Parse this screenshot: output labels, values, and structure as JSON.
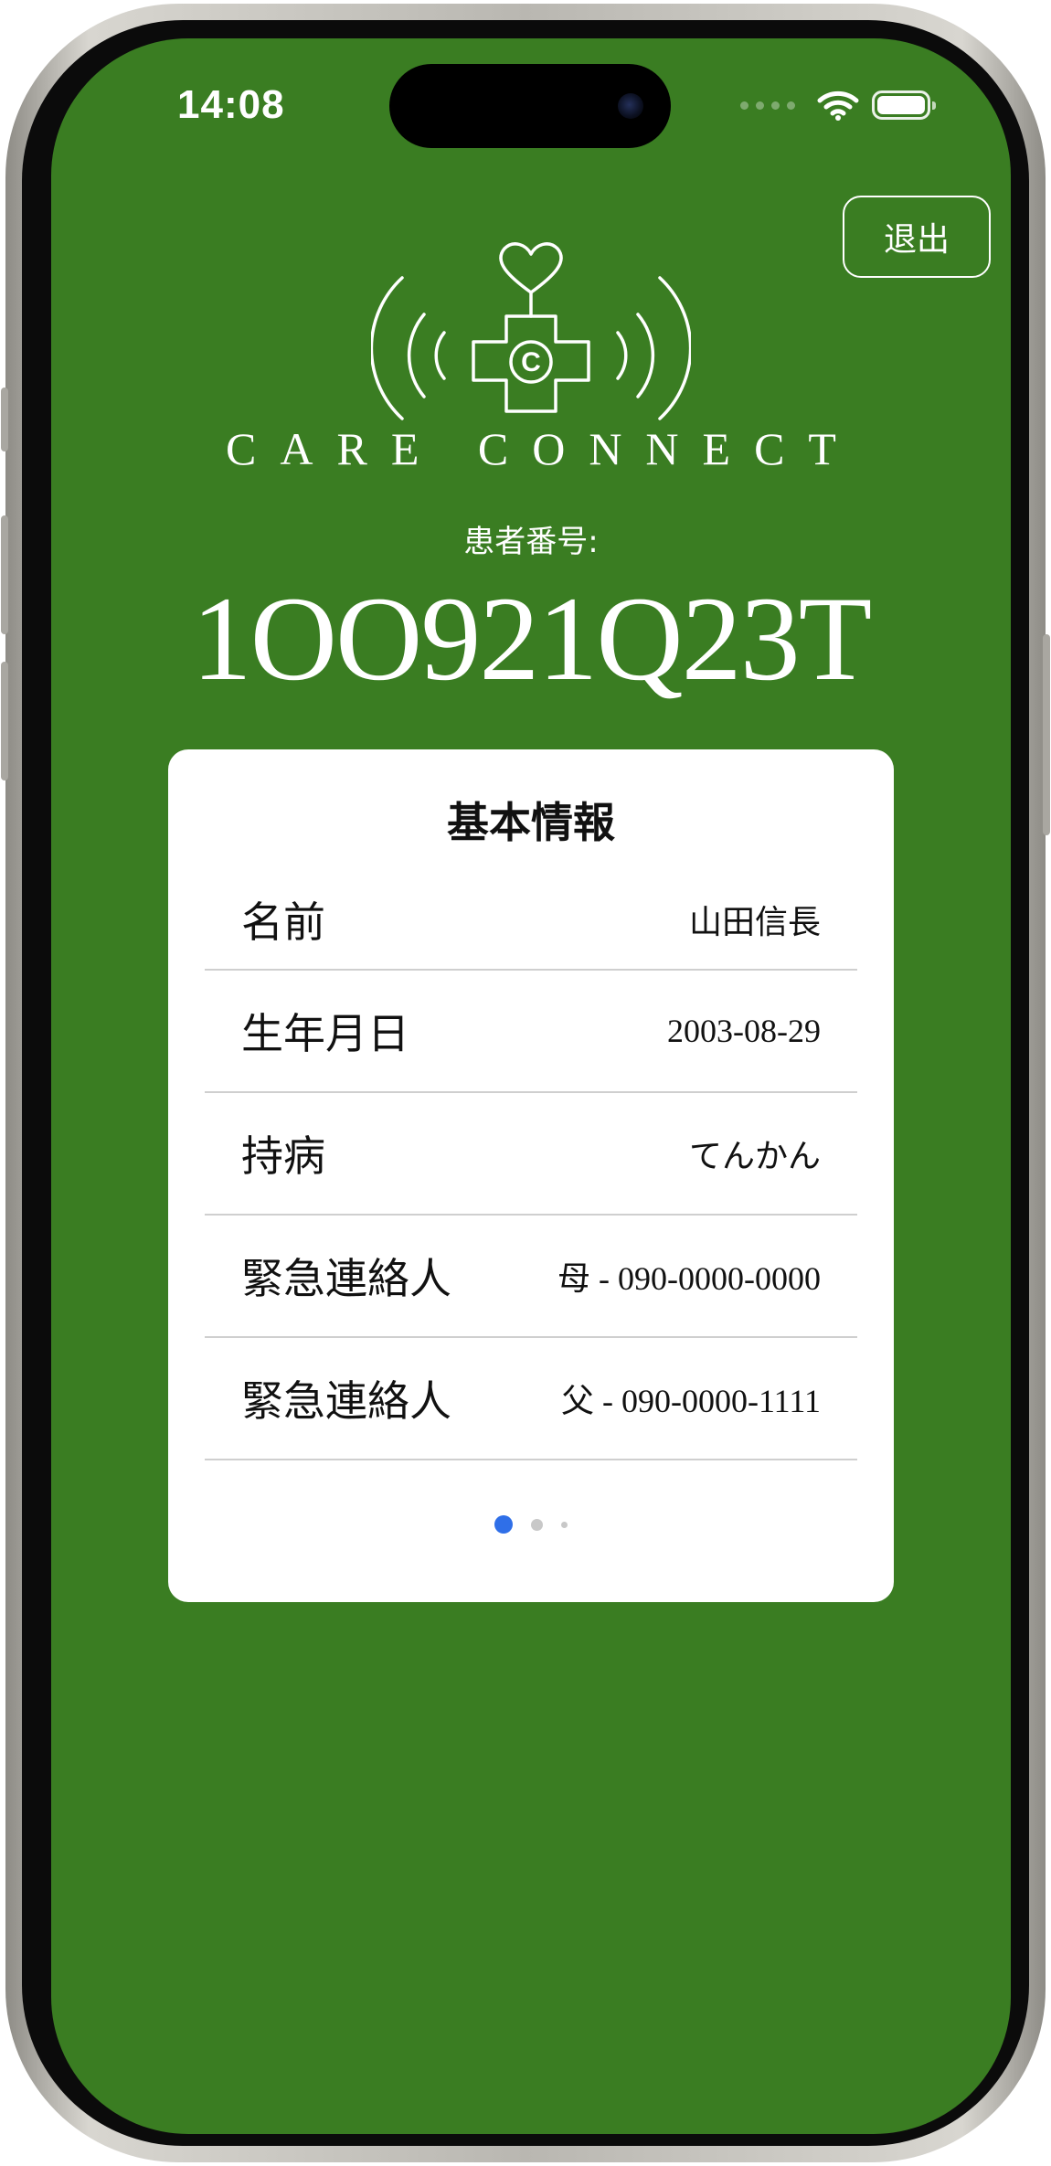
{
  "colors": {
    "background": "#3a7d22",
    "card": "#ffffff",
    "accent_dot": "#2f6fe8"
  },
  "status_bar": {
    "time": "14:08",
    "icons": [
      "signal-icon",
      "wifi-icon",
      "battery-icon"
    ]
  },
  "header": {
    "logout_label": "退出",
    "logo_icon": "heart-cross-signal-logo",
    "logo_text": "CARE CONNECT"
  },
  "patient": {
    "label": "患者番号:",
    "id": "1OO921Q23T"
  },
  "card": {
    "title": "基本情報",
    "rows": [
      {
        "label": "名前",
        "value": "山田信長"
      },
      {
        "label": "生年月日",
        "value": "2003-08-29"
      },
      {
        "label": "持病",
        "value": "てんかん"
      },
      {
        "label": "緊急連絡人",
        "value": "母 - 090-0000-0000"
      },
      {
        "label": "緊急連絡人",
        "value": "父 - 090-0000-1111"
      }
    ],
    "pager": {
      "pages": 3,
      "current": 1
    }
  }
}
